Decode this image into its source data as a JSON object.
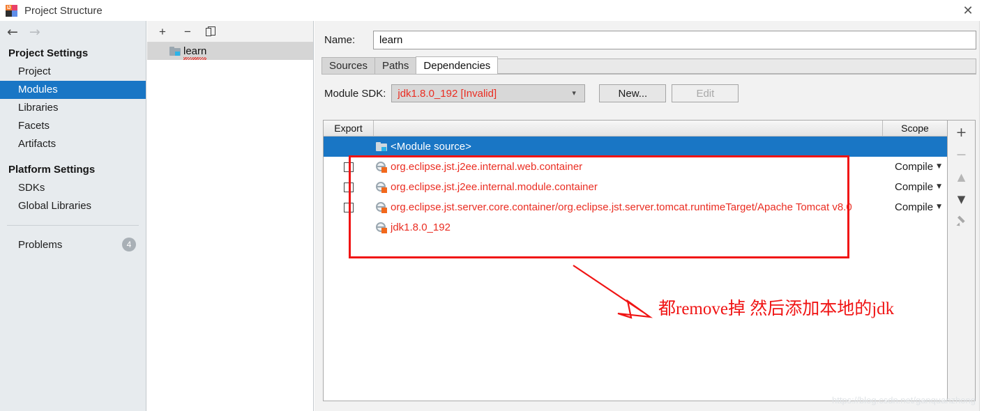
{
  "window": {
    "title": "Project Structure",
    "app_icon": "intellij-idea-icon",
    "close_label": "✕"
  },
  "sidebar": {
    "back_label": "←",
    "forward_label": "→",
    "sections": [
      {
        "heading": "Project Settings",
        "items": [
          {
            "label": "Project",
            "selected": false
          },
          {
            "label": "Modules",
            "selected": true
          },
          {
            "label": "Libraries",
            "selected": false
          },
          {
            "label": "Facets",
            "selected": false
          },
          {
            "label": "Artifacts",
            "selected": false
          }
        ]
      },
      {
        "heading": "Platform Settings",
        "items": [
          {
            "label": "SDKs",
            "selected": false
          },
          {
            "label": "Global Libraries",
            "selected": false
          }
        ]
      }
    ],
    "problems": {
      "label": "Problems",
      "count": "4"
    }
  },
  "modules_pane": {
    "toolbar": {
      "add_label": "+",
      "remove_label": "−",
      "copy_label": "copy-icon"
    },
    "items": [
      {
        "label": "learn",
        "selected": true,
        "has_error_squiggle": true
      }
    ]
  },
  "detail": {
    "name_field": {
      "label": "Name:",
      "value": "learn",
      "placeholder": ""
    },
    "tabs": [
      {
        "label": "Sources",
        "active": false
      },
      {
        "label": "Paths",
        "active": false
      },
      {
        "label": "Dependencies",
        "active": true
      }
    ],
    "sdk_row": {
      "label": "Module SDK:",
      "value": "jdk1.8.0_192 [Invalid]",
      "chevron": "chevron-down-icon",
      "new_button": "New...",
      "edit_button": "Edit"
    },
    "table": {
      "columns": [
        "Export",
        "",
        "Scope"
      ],
      "rows": [
        {
          "export_checkbox": null,
          "icon": "module-source-folder-icon",
          "name": "<Module source>",
          "scope": "",
          "selected": true
        },
        {
          "export_checkbox": false,
          "icon": "library-icon",
          "name": "org.eclipse.jst.j2ee.internal.web.container",
          "scope": "Compile",
          "selected": false
        },
        {
          "export_checkbox": false,
          "icon": "library-icon",
          "name": "org.eclipse.jst.j2ee.internal.module.container",
          "scope": "Compile",
          "selected": false
        },
        {
          "export_checkbox": false,
          "icon": "library-icon",
          "name": "org.eclipse.jst.server.core.container/org.eclipse.jst.server.tomcat.runtimeTarget/Apache Tomcat v8.0",
          "scope": "Compile",
          "selected": false
        },
        {
          "export_checkbox": null,
          "icon": "library-icon",
          "name": "jdk1.8.0_192",
          "scope": "",
          "selected": false
        }
      ],
      "side_buttons": [
        {
          "name": "add",
          "label": "+",
          "enabled": true
        },
        {
          "name": "remove",
          "label": "−",
          "enabled": false
        },
        {
          "name": "move-up",
          "label": "▲",
          "enabled": false
        },
        {
          "name": "move-down",
          "label": "▼",
          "enabled": true
        },
        {
          "name": "edit",
          "label": "pencil-icon",
          "enabled": false
        }
      ]
    }
  },
  "annotation": {
    "text": "都remove掉  然后添加本地的jdk",
    "color": "#f01414"
  },
  "watermark": {
    "text": "https://blog.csdn.net/ganquanzhong"
  },
  "colors": {
    "accent_blue": "#1976c5",
    "error_red": "#ea2d22",
    "annotation_red": "#f01414",
    "sidebar_bg": "#e7ebee",
    "panel_bg": "#f2f2f2"
  }
}
